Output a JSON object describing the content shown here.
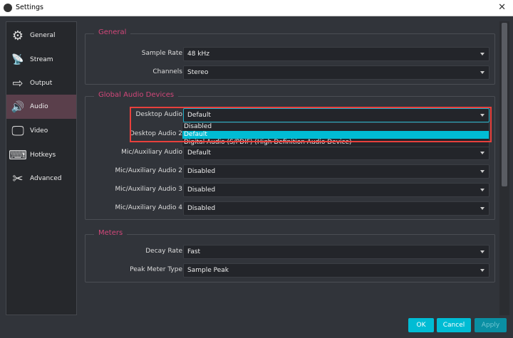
{
  "window": {
    "title": "Settings"
  },
  "sidebar": {
    "items": [
      {
        "label": "General",
        "icon": "gear-icon",
        "glyph": "⚙"
      },
      {
        "label": "Stream",
        "icon": "antenna-icon",
        "glyph": "📡"
      },
      {
        "label": "Output",
        "icon": "output-monitor-icon",
        "glyph": "⇨"
      },
      {
        "label": "Audio",
        "icon": "speaker-icon",
        "glyph": "🔊"
      },
      {
        "label": "Video",
        "icon": "monitor-icon",
        "glyph": "🖵"
      },
      {
        "label": "Hotkeys",
        "icon": "keyboard-icon",
        "glyph": "⌨"
      },
      {
        "label": "Advanced",
        "icon": "tools-icon",
        "glyph": "✂"
      }
    ],
    "active": "Audio"
  },
  "general": {
    "title": "General",
    "sample_rate_label": "Sample Rate",
    "sample_rate": "48 kHz",
    "channels_label": "Channels",
    "channels": "Stereo"
  },
  "devices": {
    "title": "Global Audio Devices",
    "desktop_label": "Desktop Audio",
    "desktop": "Default",
    "desktop2_label": "Desktop Audio 2",
    "mic1_label": "Mic/Auxiliary Audio",
    "mic1": "Default",
    "mic2_label": "Mic/Auxiliary Audio 2",
    "mic2": "Disabled",
    "mic3_label": "Mic/Auxiliary Audio 3",
    "mic3": "Disabled",
    "mic4_label": "Mic/Auxiliary Audio 4",
    "mic4": "Disabled",
    "dropdown_options": [
      "Disabled",
      "Default",
      "Digital Audio (S/PDIF) (High Definition Audio Device)"
    ],
    "dropdown_selected": "Default"
  },
  "meters": {
    "title": "Meters",
    "decay_label": "Decay Rate",
    "decay": "Fast",
    "peak_label": "Peak Meter Type",
    "peak": "Sample Peak"
  },
  "buttons": {
    "ok": "OK",
    "cancel": "Cancel",
    "apply": "Apply"
  }
}
